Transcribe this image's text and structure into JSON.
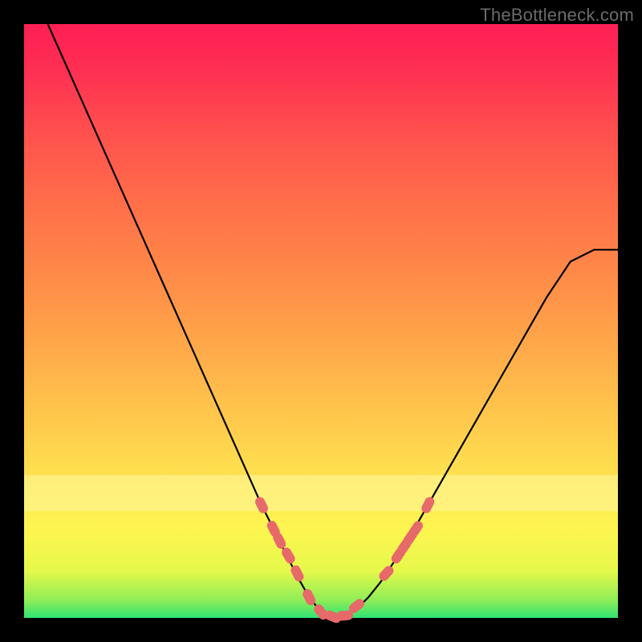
{
  "watermark": "TheBottleneck.com",
  "colors": {
    "frame": "#000000",
    "gradient_top": "#fe1f55",
    "gradient_mid": "#ffd24d",
    "gradient_bottom": "#2fe373",
    "curve": "#000000",
    "marker_fill": "#e76a6a",
    "marker_stroke": "#c94f4f",
    "band": "#fff7a0"
  },
  "chart_data": {
    "type": "line",
    "title": "",
    "xlabel": "",
    "ylabel": "",
    "xlim": [
      0,
      100
    ],
    "ylim": [
      0,
      100
    ],
    "grid": false,
    "legend": false,
    "series": [
      {
        "name": "bottleneck-curve",
        "x": [
          4,
          8,
          12,
          16,
          20,
          24,
          28,
          32,
          36,
          40,
          42,
          44,
          46,
          48,
          50,
          52,
          54,
          56,
          58,
          60,
          64,
          68,
          72,
          76,
          80,
          84,
          88,
          92,
          96,
          100
        ],
        "y": [
          100,
          91,
          82,
          73,
          64,
          55,
          46,
          37,
          28,
          19,
          15,
          11,
          7,
          3.5,
          1,
          0.2,
          0.2,
          1.5,
          3.5,
          6,
          12,
          19,
          26,
          33,
          40,
          47,
          54,
          60,
          62,
          62
        ]
      }
    ],
    "markers": {
      "name": "highlighted-points",
      "x": [
        40,
        42,
        43,
        44.5,
        46,
        48,
        50,
        52,
        54,
        56,
        61,
        63,
        64,
        65,
        66,
        68
      ],
      "y": [
        19,
        15,
        13,
        10.5,
        7.5,
        3.5,
        1,
        0.2,
        0.4,
        2,
        7.5,
        10.5,
        12,
        13.5,
        15,
        19
      ]
    },
    "band": {
      "y0": 18,
      "y1": 24
    }
  }
}
